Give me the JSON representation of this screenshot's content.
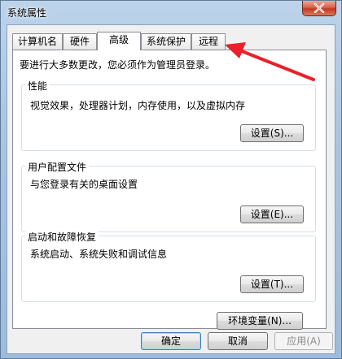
{
  "window": {
    "title": "系统属性"
  },
  "tabs": [
    {
      "label": "计算机名"
    },
    {
      "label": "硬件"
    },
    {
      "label": "高级"
    },
    {
      "label": "系统保护"
    },
    {
      "label": "远程"
    }
  ],
  "panel": {
    "admin_note": "要进行大多数更改，您必须作为管理员登录。",
    "performance": {
      "title": "性能",
      "desc": "视觉效果，处理器计划，内存使用，以及虚拟内存",
      "button": "设置(S)..."
    },
    "profiles": {
      "title": "用户配置文件",
      "desc": "与您登录有关的桌面设置",
      "button": "设置(E)..."
    },
    "startup": {
      "title": "启动和故障恢复",
      "desc": "系统启动、系统失败和调试信息",
      "button": "设置(T)..."
    },
    "env_button": "环境变量(N)..."
  },
  "footer": {
    "ok": "确定",
    "cancel": "取消",
    "apply": "应用(A)"
  },
  "colors": {
    "annotation_arrow": "#e8212c"
  }
}
